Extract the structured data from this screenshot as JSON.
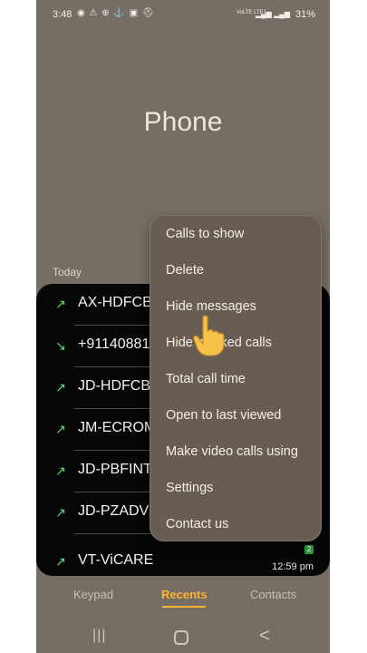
{
  "status_bar": {
    "time": "3:48",
    "notification_icons": "◉ ⚠ ⊕ ⚓ ▣ ⛑",
    "network_label": "VoLTE LTE1",
    "signal_icons": "▂▄▆ ▂▄▆",
    "battery": "31%"
  },
  "app": {
    "title": "Phone"
  },
  "recents": {
    "section_label": "Today",
    "calls": [
      {
        "name": "AX-HDFCBK",
        "type": "incoming",
        "icon": "incoming-call-icon"
      },
      {
        "name": "+9114088115",
        "type": "missed",
        "icon": "missed-call-icon"
      },
      {
        "name": "JD-HDFCBK",
        "type": "incoming",
        "icon": "incoming-call-icon"
      },
      {
        "name": "JM-ECROM",
        "type": "incoming",
        "icon": "incoming-call-icon"
      },
      {
        "name": "JD-PBFINT",
        "type": "incoming",
        "icon": "incoming-call-icon"
      },
      {
        "name": "JD-PZADVS",
        "type": "incoming",
        "icon": "incoming-call-icon"
      },
      {
        "name": "VT-ViCARE",
        "type": "incoming",
        "icon": "incoming-call-icon",
        "time": "12:59 pm",
        "badge": "2"
      }
    ]
  },
  "menu": {
    "items": [
      "Calls to show",
      "Delete",
      "Hide messages",
      "Hide blocked calls",
      "Total call time",
      "Open to last viewed",
      "Make video calls using",
      "Settings",
      "Contact us"
    ]
  },
  "tabs": {
    "keypad": "Keypad",
    "recents": "Recents",
    "contacts": "Contacts",
    "active": "recents"
  },
  "nav": {
    "recent_apps_glyph": "|||",
    "back_glyph": "<"
  },
  "colors": {
    "background": "#766e65",
    "card": "#050706",
    "menu": "#675d52",
    "accent": "#ffb234",
    "call_icon": "#6dcf75"
  }
}
